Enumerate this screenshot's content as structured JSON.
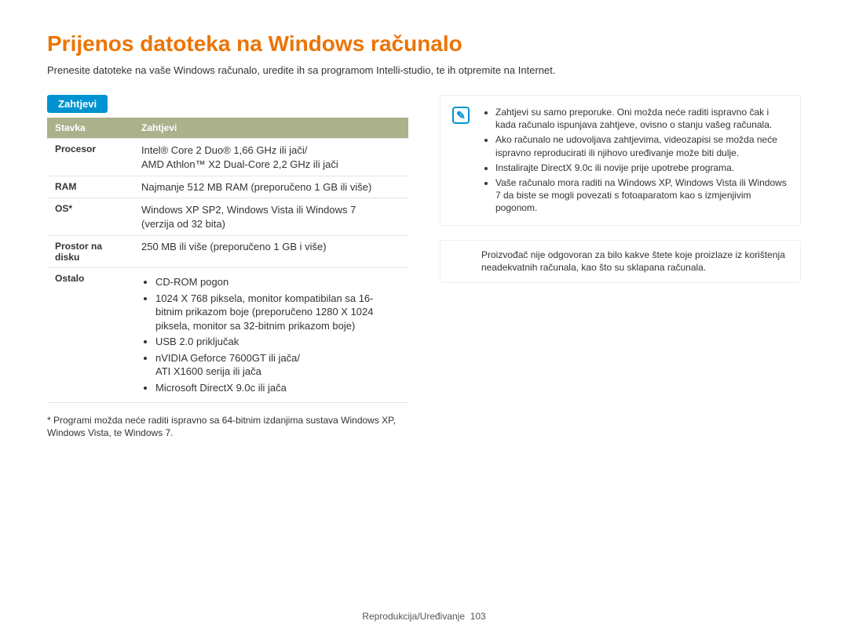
{
  "title": "Prijenos datoteka na Windows računalo",
  "intro": "Prenesite datoteke na vaše Windows računalo, uredite ih sa programom Intelli-studio, te ih otpremite na Internet.",
  "section_label": "Zahtjevi",
  "table": {
    "headers": {
      "col1": "Stavka",
      "col2": "Zahtjevi"
    },
    "rows": {
      "procesor_label": "Procesor",
      "procesor_line1": "Intel® Core 2 Duo® 1,66 GHz ili jači/",
      "procesor_line2": "AMD Athlon™ X2 Dual-Core 2,2 GHz ili jači",
      "ram_label": "RAM",
      "ram_value": "Najmanje 512 MB RAM (preporučeno 1 GB ili više)",
      "os_label": "OS*",
      "os_line1": "Windows XP SP2, Windows Vista ili Windows 7",
      "os_line2": "(verzija od 32 bita)",
      "disk_label": "Prostor na disku",
      "disk_value": "250 MB ili više (preporučeno 1 GB i više)",
      "ostalo_label": "Ostalo",
      "ostalo_items": {
        "i1": "CD-ROM pogon",
        "i2": "1024 X 768 piksela, monitor kompatibilan sa 16-bitnim prikazom boje (preporučeno 1280 X 1024 piksela, monitor sa 32-bitnim prikazom boje)",
        "i3": "USB 2.0 priključak",
        "i4a": "nVIDIA Geforce 7600GT ili jača/",
        "i4b": "ATI X1600 serija ili jača",
        "i5": "Microsoft DirectX 9.0c ili jača"
      }
    }
  },
  "footnote": "* Programi možda neće raditi ispravno sa 64-bitnim izdanjima sustava Windows XP, Windows Vista, te Windows 7.",
  "note": {
    "b1": "Zahtjevi su samo preporuke. Oni možda neće raditi ispravno čak i kada računalo ispunjava zahtjeve, ovisno o stanju vašeg računala.",
    "b2": "Ako računalo ne udovoljava zahtjevima, videozapisi se možda neće ispravno reproducirati ili njihovo uređivanje može biti dulje.",
    "b3": "Instalirajte DirectX 9.0c ili novije prije upotrebe programa.",
    "b4": "Vaše računalo mora raditi na Windows XP, Windows Vista ili Windows 7 da biste se mogli povezati s fotoaparatom kao s izmjenjivim pogonom."
  },
  "warning": "Proizvođač nije odgovoran za bilo kakve štete koje proizlaze iz korištenja neadekvatnih računala, kao što su sklapana računala.",
  "footer": {
    "section": "Reprodukcija/Uređivanje",
    "page": "103"
  }
}
